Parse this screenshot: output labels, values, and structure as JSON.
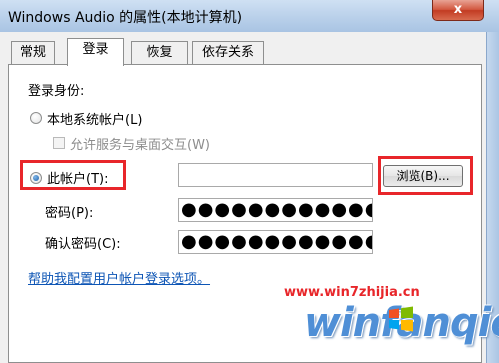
{
  "window": {
    "title": "Windows Audio 的属性(本地计算机)",
    "close_glyph": "x"
  },
  "tabs": [
    {
      "label": "常规",
      "active": false
    },
    {
      "label": "登录",
      "active": true
    },
    {
      "label": "恢复",
      "active": false
    },
    {
      "label": "依存关系",
      "active": false
    }
  ],
  "logon": {
    "section_label": "登录身份:",
    "local_system_label": "本地系统帐户(L)",
    "interact_desktop_label": "允许服务与桌面交互(W)",
    "this_account_label": "此帐户(T):",
    "account_value": "",
    "browse_label": "浏览(B)...",
    "password_label": "密码(P):",
    "password_value": "●●●●●●●●●●●●●●●",
    "confirm_label": "确认密码(C):",
    "confirm_value": "●●●●●●●●●●●●●●●",
    "help_link": "帮助我配置用户帐户登录选项。",
    "selected_option": "this_account"
  },
  "watermark": {
    "url": "www.win7zhijia.cn",
    "brand": "winfanqie"
  },
  "colors": {
    "highlight_box": "#e8262a",
    "link": "#0d55b5",
    "brand": "#4f8fd6"
  }
}
